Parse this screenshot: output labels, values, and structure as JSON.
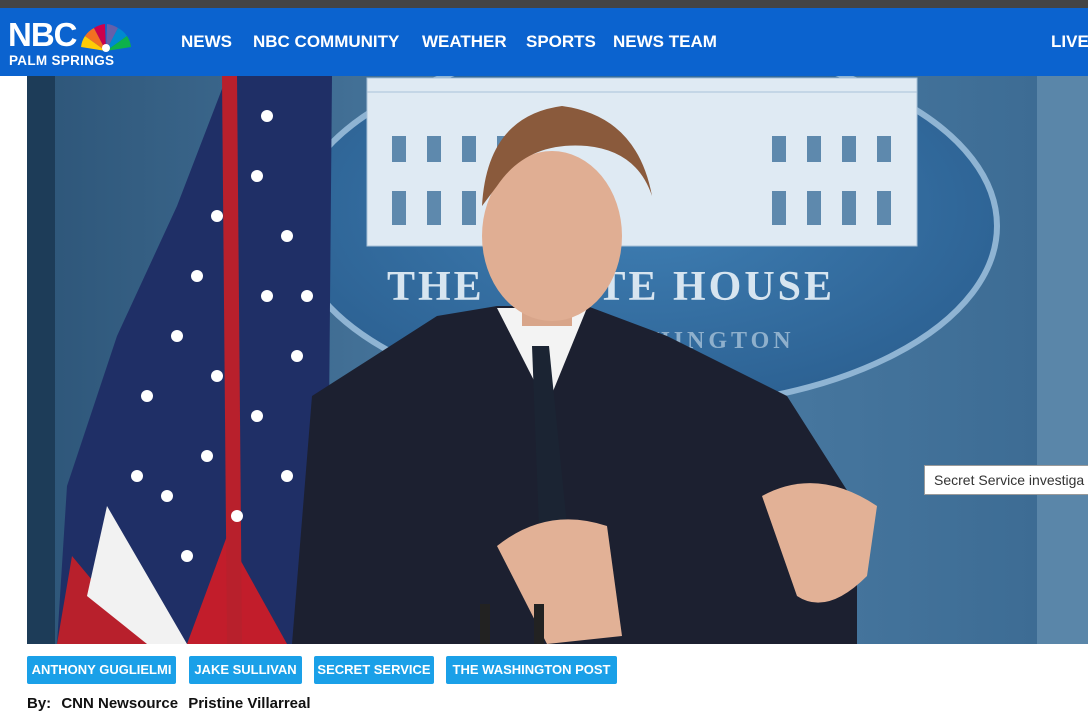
{
  "header": {
    "logo": {
      "brand": "NBC",
      "station": "PALM SPRINGS",
      "icon": "nbc-peacock-icon"
    },
    "nav": [
      {
        "label": "NEWS"
      },
      {
        "label": "NBC COMMUNITY"
      },
      {
        "label": "WEATHER"
      },
      {
        "label": "SPORTS"
      },
      {
        "label": "NEWS TEAM"
      },
      {
        "label": "LIVE"
      }
    ]
  },
  "article": {
    "hero_image": {
      "podium_text": "THE WHITE HOUSE",
      "podium_subtext": "WASHINGTON"
    },
    "tooltip": "Secret Service investiga",
    "tags": [
      {
        "label": "ANTHONY GUGLIELMI"
      },
      {
        "label": "JAKE SULLIVAN"
      },
      {
        "label": "SECRET SERVICE"
      },
      {
        "label": "THE WASHINGTON POST"
      }
    ],
    "byline": {
      "prefix": "By:",
      "authors": [
        "CNN Newsource",
        "Pristine Villarreal"
      ]
    }
  },
  "colors": {
    "nav_bg": "#0b63cf",
    "tag_bg": "#1aa0e8",
    "top_strip": "#444444"
  }
}
